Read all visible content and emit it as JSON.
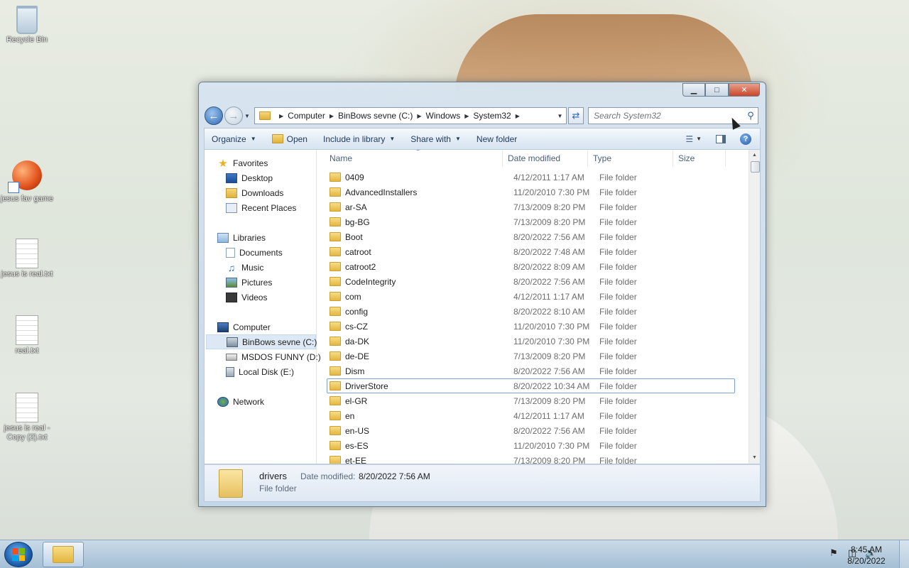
{
  "desktop": {
    "icons": [
      {
        "label": "Recycle Bin",
        "icon": "recycle-bin-icon"
      },
      {
        "label": "jesus fav game",
        "icon": "game-shortcut-icon"
      },
      {
        "label": "jesus is real.txt",
        "icon": "text-file-icon"
      },
      {
        "label": "real.txt",
        "icon": "text-file-icon"
      },
      {
        "label": "jesus is real - Copy (2).txt",
        "icon": "text-file-icon"
      }
    ]
  },
  "window": {
    "caption_buttons": {
      "minimize": "▁",
      "maximize": "□",
      "close": "✕"
    },
    "address": {
      "crumbs": [
        "Computer",
        "BinBows sevne (C:)",
        "Windows",
        "System32"
      ]
    },
    "search": {
      "placeholder": "Search System32"
    },
    "toolbar": {
      "organize": "Organize",
      "open": "Open",
      "include": "Include in library",
      "share": "Share with",
      "new_folder": "New folder",
      "help": "?"
    },
    "nav": {
      "favorites": "Favorites",
      "desktop": "Desktop",
      "downloads": "Downloads",
      "recent": "Recent Places",
      "libraries": "Libraries",
      "documents": "Documents",
      "music": "Music",
      "pictures": "Pictures",
      "videos": "Videos",
      "computer": "Computer",
      "drive_c": "BinBows sevne (C:)",
      "drive_d": "MSDOS FUNNY (D:)",
      "drive_e": "Local Disk (E:)",
      "network": "Network"
    },
    "columns": {
      "name": "Name",
      "date": "Date modified",
      "type": "Type",
      "size": "Size"
    },
    "files": [
      {
        "name": "0409",
        "date": "4/12/2011 1:17 AM",
        "type": "File folder"
      },
      {
        "name": "AdvancedInstallers",
        "date": "11/20/2010 7:30 PM",
        "type": "File folder"
      },
      {
        "name": "ar-SA",
        "date": "7/13/2009 8:20 PM",
        "type": "File folder"
      },
      {
        "name": "bg-BG",
        "date": "7/13/2009 8:20 PM",
        "type": "File folder"
      },
      {
        "name": "Boot",
        "date": "8/20/2022 7:56 AM",
        "type": "File folder"
      },
      {
        "name": "catroot",
        "date": "8/20/2022 7:48 AM",
        "type": "File folder"
      },
      {
        "name": "catroot2",
        "date": "8/20/2022 8:09 AM",
        "type": "File folder"
      },
      {
        "name": "CodeIntegrity",
        "date": "8/20/2022 7:56 AM",
        "type": "File folder"
      },
      {
        "name": "com",
        "date": "4/12/2011 1:17 AM",
        "type": "File folder"
      },
      {
        "name": "config",
        "date": "8/20/2022 8:10 AM",
        "type": "File folder"
      },
      {
        "name": "cs-CZ",
        "date": "11/20/2010 7:30 PM",
        "type": "File folder"
      },
      {
        "name": "da-DK",
        "date": "11/20/2010 7:30 PM",
        "type": "File folder"
      },
      {
        "name": "de-DE",
        "date": "7/13/2009 8:20 PM",
        "type": "File folder"
      },
      {
        "name": "Dism",
        "date": "8/20/2022 7:56 AM",
        "type": "File folder"
      },
      {
        "name": "DriverStore",
        "date": "8/20/2022 10:34 AM",
        "type": "File folder"
      },
      {
        "name": "el-GR",
        "date": "7/13/2009 8:20 PM",
        "type": "File folder"
      },
      {
        "name": "en",
        "date": "4/12/2011 1:17 AM",
        "type": "File folder"
      },
      {
        "name": "en-US",
        "date": "8/20/2022 7:56 AM",
        "type": "File folder"
      },
      {
        "name": "es-ES",
        "date": "11/20/2010 7:30 PM",
        "type": "File folder"
      },
      {
        "name": "et-EE",
        "date": "7/13/2009 8:20 PM",
        "type": "File folder"
      }
    ],
    "details": {
      "name": "drivers",
      "type": "File folder",
      "date_label": "Date modified:",
      "date_value": "8/20/2022 7:56 AM"
    }
  },
  "taskbar": {
    "clock_time": "8:45 AM",
    "clock_date": "8/20/2022"
  }
}
